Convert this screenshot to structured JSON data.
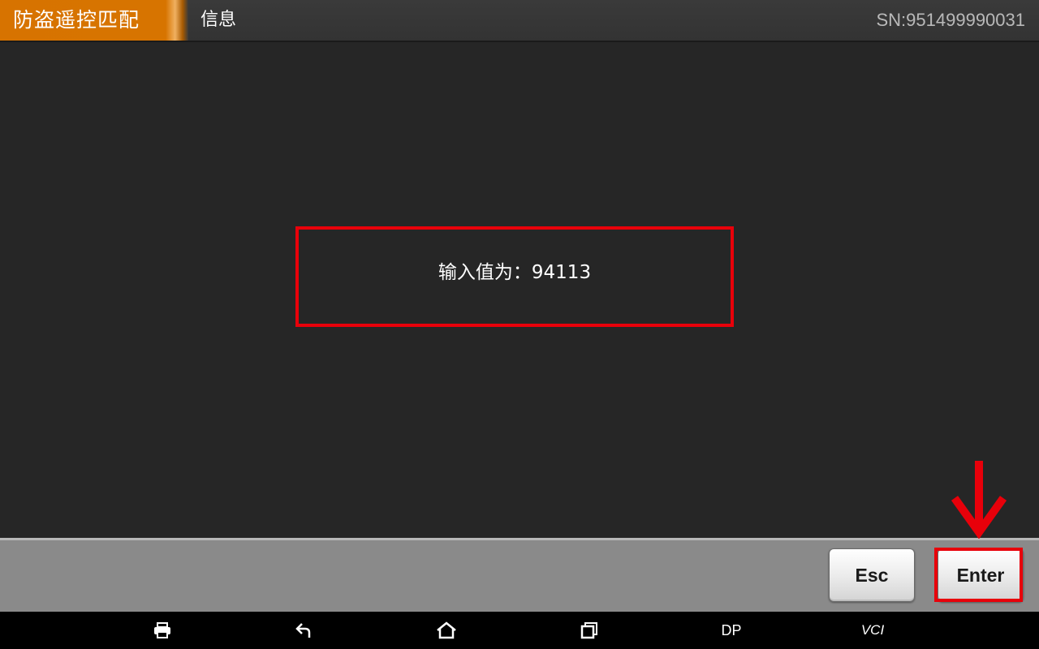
{
  "header": {
    "title": "防盗遥控匹配",
    "subtitle": "信息",
    "serial": "SN:951499990031"
  },
  "message": {
    "text": "输入值为：94113"
  },
  "buttons": {
    "esc_label": "Esc",
    "enter_label": "Enter"
  },
  "navbar": {
    "items": [
      {
        "icon": "print-icon"
      },
      {
        "icon": "back-icon"
      },
      {
        "icon": "home-icon"
      },
      {
        "icon": "recent-apps-icon"
      },
      {
        "label": "DP"
      },
      {
        "label": "VCI"
      }
    ]
  },
  "colors": {
    "accent_orange": "#d77300",
    "highlight_red": "#e8000a",
    "background": "#262626",
    "button_bar": "#8a8a8a"
  }
}
